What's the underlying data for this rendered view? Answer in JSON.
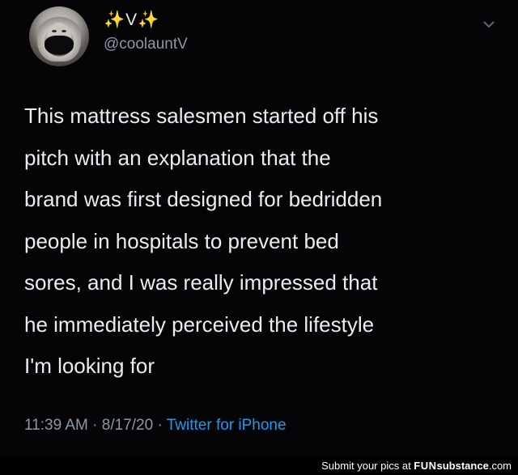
{
  "user": {
    "display_name": "✨V✨",
    "handle": "@coolauntV"
  },
  "tweet": {
    "text_lines": [
      "This mattress salesmen started off his",
      "pitch with an explanation that the",
      "brand was first designed for bedridden",
      "people in hospitals to prevent bed",
      "sores, and I was really impressed that",
      "he immediately perceived the lifestyle",
      "I'm looking for"
    ],
    "time": "11:39 AM",
    "separator": "·",
    "date": "8/17/20",
    "separator2": "·",
    "source": "Twitter for iPhone"
  },
  "watermark": {
    "prefix": "Submit your pics at ",
    "brand_fun": "FUN",
    "brand_sub": "substance",
    "suffix": ".com"
  },
  "colors": {
    "background": "#050507",
    "text": "#e7e9ea",
    "secondary": "#8b98a5",
    "link": "#1d9bf0"
  },
  "icons": {
    "caret": "chevron-down-icon"
  }
}
